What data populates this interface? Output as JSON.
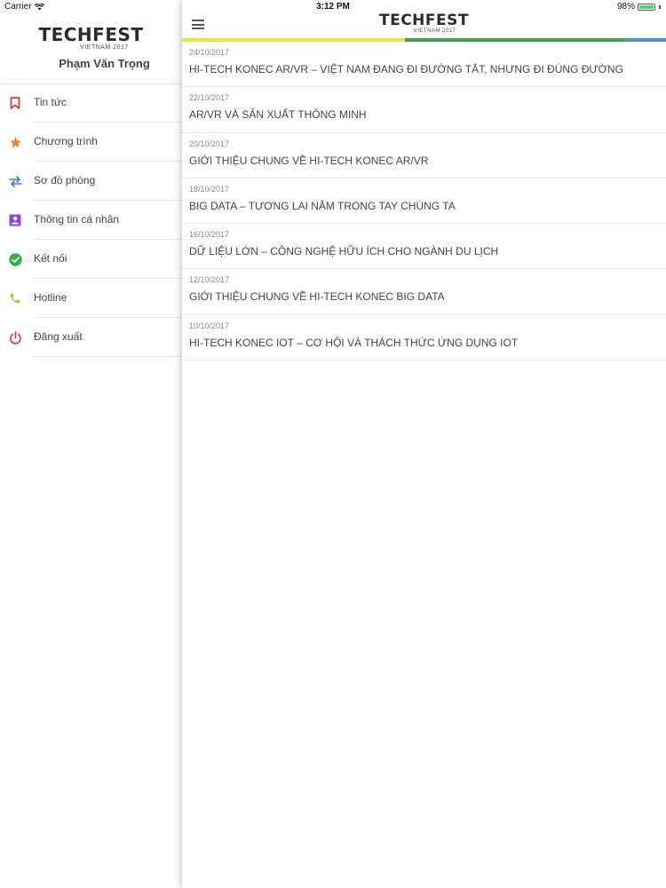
{
  "status_bar": {
    "carrier": "Carrier",
    "time": "3:12 PM",
    "battery": "98%",
    "battery_level": 0.98
  },
  "brand": {
    "logo": "TECHFEST",
    "logo_sub": "VIETNAM 2017"
  },
  "sidebar": {
    "user_name": "Phạm Văn Trọng",
    "items": [
      {
        "label": "Tin tức",
        "icon": "bookmark-icon",
        "color": "#e53935"
      },
      {
        "label": "Chương trình",
        "icon": "star-icon",
        "color": "#f4842a"
      },
      {
        "label": "Sơ đồ phòng",
        "icon": "swap-arrows-icon",
        "color": "#3d7fd6"
      },
      {
        "label": "Thông tin cá nhân",
        "icon": "contact-card-icon",
        "color": "#8e44d6"
      },
      {
        "label": "Kết nối",
        "icon": "check-circle-icon",
        "color": "#2fae4a"
      },
      {
        "label": "Hotline",
        "icon": "phone-icon",
        "color": "#f4a31b"
      },
      {
        "label": "Đăng xuất",
        "icon": "power-icon",
        "color": "#e53935"
      }
    ]
  },
  "header": {
    "menu_icon": "hamburger-icon"
  },
  "news": [
    {
      "date": "24/10/2017",
      "title": "HI-TECH KONEC AR/VR – VIỆT NAM ĐANG ĐI ĐƯỜNG TẮT, NHƯNG ĐI ĐÚNG ĐƯỜNG"
    },
    {
      "date": "22/10/2017",
      "title": "AR/VR VÀ SẢN XUẤT THÔNG MINH"
    },
    {
      "date": "20/10/2017",
      "title": "GIỚI THIỆU CHUNG VỀ HI-TECH KONEC AR/VR"
    },
    {
      "date": "18/10/2017",
      "title": "BIG DATA – TƯƠNG LAI NẰM TRONG TAY CHÚNG TA"
    },
    {
      "date": "16/10/2017",
      "title": "DỮ LIỆU LỚN – CÔNG NGHỆ HỮU ÍCH CHO NGÀNH DU LỊCH"
    },
    {
      "date": "12/10/2017",
      "title": "GIỚI THIỆU CHUNG VỀ HI-TECH KONEC BIG DATA"
    },
    {
      "date": "10/10/2017",
      "title": "HI-TECH KONEC IOT – CƠ HỘI VÀ THÁCH THỨC ỨNG DỤNG IOT"
    }
  ],
  "colors": {
    "yellow": "#f2e33a",
    "green": "#37a84a",
    "blue": "#4a90d9"
  }
}
